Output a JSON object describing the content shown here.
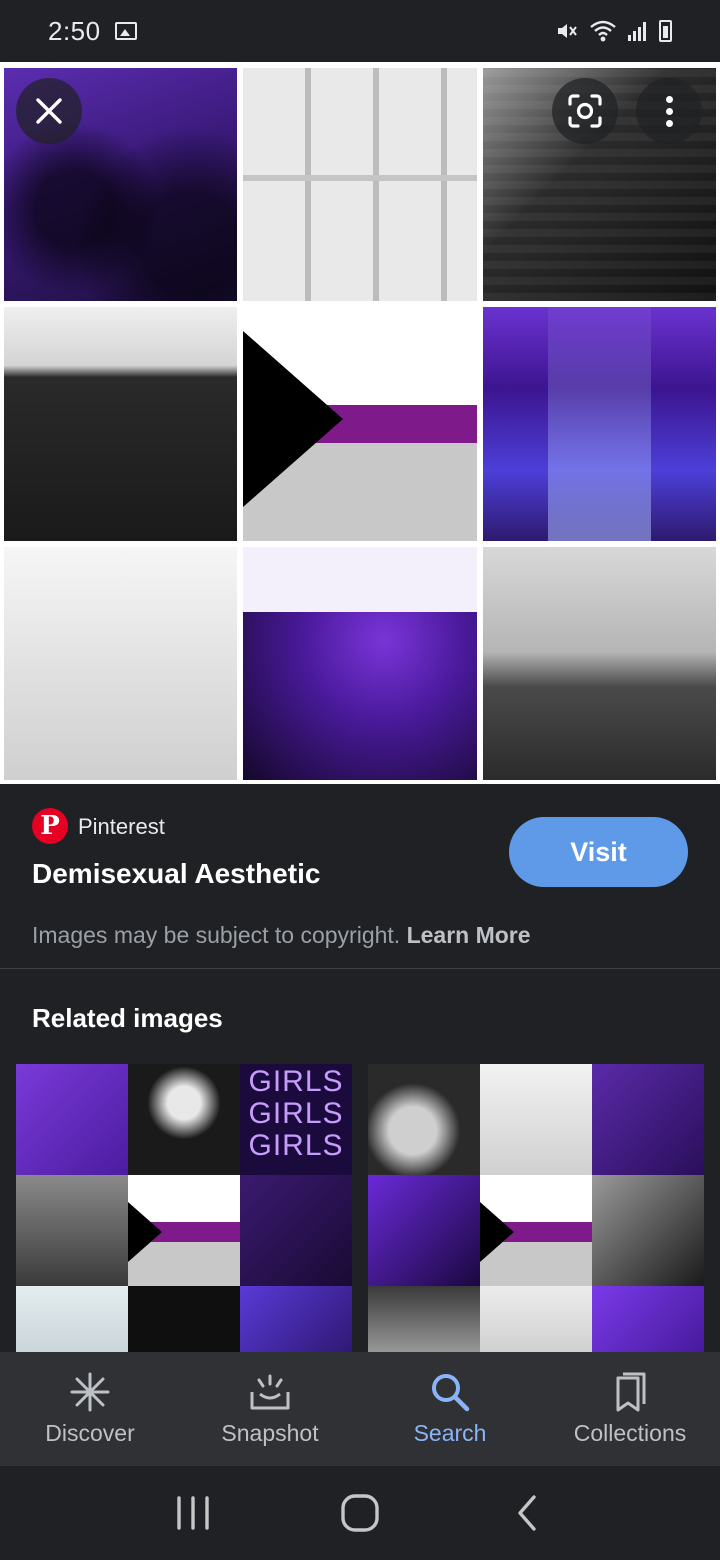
{
  "status_bar": {
    "time": "2:50",
    "icons": [
      "gallery-icon",
      "mute-icon",
      "wifi-icon",
      "signal-icon",
      "battery-icon"
    ]
  },
  "viewer": {
    "close_icon": "close-icon",
    "lens_icon": "lens-icon",
    "more_icon": "more-vert-icon",
    "collage_tiles": 9
  },
  "source": {
    "site_name": "Pinterest",
    "page_title": "Demisexual Aesthetic",
    "visit_label": "Visit",
    "copyright_text": "Images may be subject to copyright.",
    "learn_more_label": "Learn More"
  },
  "related": {
    "title": "Related images",
    "neon_text": "GIRLS GIRLS GIRLS"
  },
  "bottom_nav": {
    "items": [
      {
        "label": "Discover",
        "icon": "asterisk-icon"
      },
      {
        "label": "Snapshot",
        "icon": "snapshot-icon"
      },
      {
        "label": "Search",
        "icon": "search-icon",
        "active": true
      },
      {
        "label": "Collections",
        "icon": "bookmarks-icon"
      }
    ]
  },
  "colors": {
    "background": "#202124",
    "accent": "#8ab4f8",
    "visit_button": "#5f9ae8",
    "pinterest_red": "#e60023"
  }
}
